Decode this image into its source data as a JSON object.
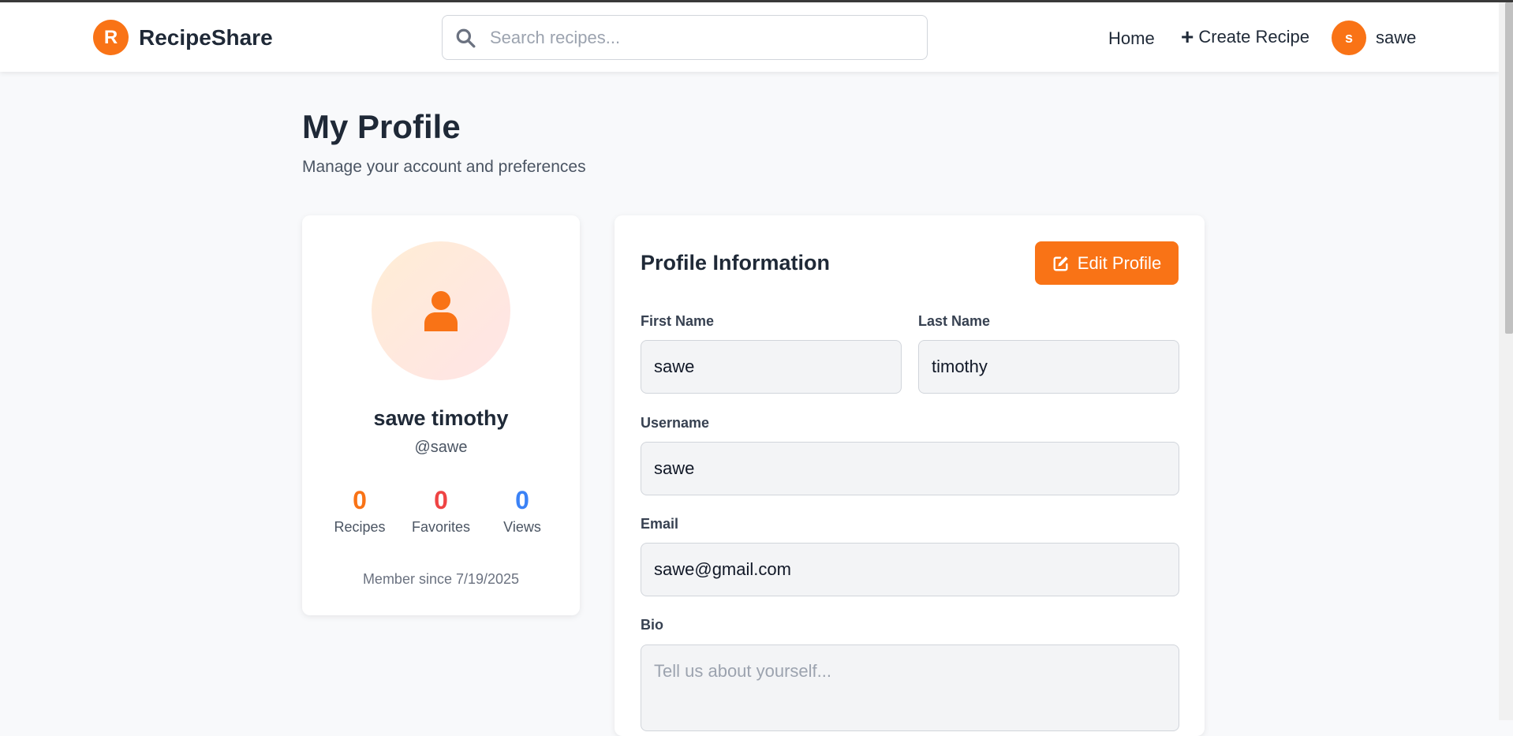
{
  "header": {
    "logo_letter": "R",
    "app_name": "RecipeShare",
    "search_placeholder": "Search recipes...",
    "nav_home": "Home",
    "nav_create": "Create Recipe",
    "user_initial": "s",
    "username": "sawe"
  },
  "page": {
    "title": "My Profile",
    "subtitle": "Manage your account and preferences"
  },
  "profile_card": {
    "full_name": "sawe timothy",
    "handle": "@sawe",
    "stats": [
      {
        "value": "0",
        "label": "Recipes",
        "color": "#f97316"
      },
      {
        "value": "0",
        "label": "Favorites",
        "color": "#ef4444"
      },
      {
        "value": "0",
        "label": "Views",
        "color": "#3b82f6"
      }
    ],
    "member_since": "Member since 7/19/2025"
  },
  "profile_info": {
    "title": "Profile Information",
    "edit_button": "Edit Profile",
    "fields": {
      "first_name": {
        "label": "First Name",
        "value": "sawe"
      },
      "last_name": {
        "label": "Last Name",
        "value": "timothy"
      },
      "username": {
        "label": "Username",
        "value": "sawe"
      },
      "email": {
        "label": "Email",
        "value": "sawe@gmail.com"
      },
      "bio": {
        "label": "Bio",
        "value": "",
        "placeholder": "Tell us about yourself..."
      }
    }
  },
  "colors": {
    "accent": "#f97316",
    "favorites": "#ef4444",
    "views": "#3b82f6"
  }
}
